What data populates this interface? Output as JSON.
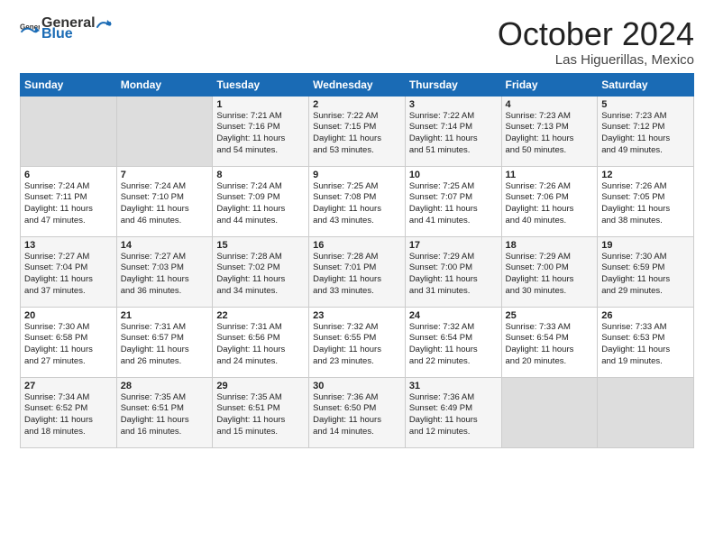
{
  "header": {
    "logo_general": "General",
    "logo_blue": "Blue",
    "month": "October 2024",
    "location": "Las Higuerillas, Mexico"
  },
  "days_of_week": [
    "Sunday",
    "Monday",
    "Tuesday",
    "Wednesday",
    "Thursday",
    "Friday",
    "Saturday"
  ],
  "weeks": [
    [
      {
        "day": "",
        "empty": true
      },
      {
        "day": "",
        "empty": true
      },
      {
        "day": "1",
        "lines": [
          "Sunrise: 7:21 AM",
          "Sunset: 7:16 PM",
          "Daylight: 11 hours",
          "and 54 minutes."
        ]
      },
      {
        "day": "2",
        "lines": [
          "Sunrise: 7:22 AM",
          "Sunset: 7:15 PM",
          "Daylight: 11 hours",
          "and 53 minutes."
        ]
      },
      {
        "day": "3",
        "lines": [
          "Sunrise: 7:22 AM",
          "Sunset: 7:14 PM",
          "Daylight: 11 hours",
          "and 51 minutes."
        ]
      },
      {
        "day": "4",
        "lines": [
          "Sunrise: 7:23 AM",
          "Sunset: 7:13 PM",
          "Daylight: 11 hours",
          "and 50 minutes."
        ]
      },
      {
        "day": "5",
        "lines": [
          "Sunrise: 7:23 AM",
          "Sunset: 7:12 PM",
          "Daylight: 11 hours",
          "and 49 minutes."
        ]
      }
    ],
    [
      {
        "day": "6",
        "lines": [
          "Sunrise: 7:24 AM",
          "Sunset: 7:11 PM",
          "Daylight: 11 hours",
          "and 47 minutes."
        ]
      },
      {
        "day": "7",
        "lines": [
          "Sunrise: 7:24 AM",
          "Sunset: 7:10 PM",
          "Daylight: 11 hours",
          "and 46 minutes."
        ]
      },
      {
        "day": "8",
        "lines": [
          "Sunrise: 7:24 AM",
          "Sunset: 7:09 PM",
          "Daylight: 11 hours",
          "and 44 minutes."
        ]
      },
      {
        "day": "9",
        "lines": [
          "Sunrise: 7:25 AM",
          "Sunset: 7:08 PM",
          "Daylight: 11 hours",
          "and 43 minutes."
        ]
      },
      {
        "day": "10",
        "lines": [
          "Sunrise: 7:25 AM",
          "Sunset: 7:07 PM",
          "Daylight: 11 hours",
          "and 41 minutes."
        ]
      },
      {
        "day": "11",
        "lines": [
          "Sunrise: 7:26 AM",
          "Sunset: 7:06 PM",
          "Daylight: 11 hours",
          "and 40 minutes."
        ]
      },
      {
        "day": "12",
        "lines": [
          "Sunrise: 7:26 AM",
          "Sunset: 7:05 PM",
          "Daylight: 11 hours",
          "and 38 minutes."
        ]
      }
    ],
    [
      {
        "day": "13",
        "lines": [
          "Sunrise: 7:27 AM",
          "Sunset: 7:04 PM",
          "Daylight: 11 hours",
          "and 37 minutes."
        ]
      },
      {
        "day": "14",
        "lines": [
          "Sunrise: 7:27 AM",
          "Sunset: 7:03 PM",
          "Daylight: 11 hours",
          "and 36 minutes."
        ]
      },
      {
        "day": "15",
        "lines": [
          "Sunrise: 7:28 AM",
          "Sunset: 7:02 PM",
          "Daylight: 11 hours",
          "and 34 minutes."
        ]
      },
      {
        "day": "16",
        "lines": [
          "Sunrise: 7:28 AM",
          "Sunset: 7:01 PM",
          "Daylight: 11 hours",
          "and 33 minutes."
        ]
      },
      {
        "day": "17",
        "lines": [
          "Sunrise: 7:29 AM",
          "Sunset: 7:00 PM",
          "Daylight: 11 hours",
          "and 31 minutes."
        ]
      },
      {
        "day": "18",
        "lines": [
          "Sunrise: 7:29 AM",
          "Sunset: 7:00 PM",
          "Daylight: 11 hours",
          "and 30 minutes."
        ]
      },
      {
        "day": "19",
        "lines": [
          "Sunrise: 7:30 AM",
          "Sunset: 6:59 PM",
          "Daylight: 11 hours",
          "and 29 minutes."
        ]
      }
    ],
    [
      {
        "day": "20",
        "lines": [
          "Sunrise: 7:30 AM",
          "Sunset: 6:58 PM",
          "Daylight: 11 hours",
          "and 27 minutes."
        ]
      },
      {
        "day": "21",
        "lines": [
          "Sunrise: 7:31 AM",
          "Sunset: 6:57 PM",
          "Daylight: 11 hours",
          "and 26 minutes."
        ]
      },
      {
        "day": "22",
        "lines": [
          "Sunrise: 7:31 AM",
          "Sunset: 6:56 PM",
          "Daylight: 11 hours",
          "and 24 minutes."
        ]
      },
      {
        "day": "23",
        "lines": [
          "Sunrise: 7:32 AM",
          "Sunset: 6:55 PM",
          "Daylight: 11 hours",
          "and 23 minutes."
        ]
      },
      {
        "day": "24",
        "lines": [
          "Sunrise: 7:32 AM",
          "Sunset: 6:54 PM",
          "Daylight: 11 hours",
          "and 22 minutes."
        ]
      },
      {
        "day": "25",
        "lines": [
          "Sunrise: 7:33 AM",
          "Sunset: 6:54 PM",
          "Daylight: 11 hours",
          "and 20 minutes."
        ]
      },
      {
        "day": "26",
        "lines": [
          "Sunrise: 7:33 AM",
          "Sunset: 6:53 PM",
          "Daylight: 11 hours",
          "and 19 minutes."
        ]
      }
    ],
    [
      {
        "day": "27",
        "lines": [
          "Sunrise: 7:34 AM",
          "Sunset: 6:52 PM",
          "Daylight: 11 hours",
          "and 18 minutes."
        ]
      },
      {
        "day": "28",
        "lines": [
          "Sunrise: 7:35 AM",
          "Sunset: 6:51 PM",
          "Daylight: 11 hours",
          "and 16 minutes."
        ]
      },
      {
        "day": "29",
        "lines": [
          "Sunrise: 7:35 AM",
          "Sunset: 6:51 PM",
          "Daylight: 11 hours",
          "and 15 minutes."
        ]
      },
      {
        "day": "30",
        "lines": [
          "Sunrise: 7:36 AM",
          "Sunset: 6:50 PM",
          "Daylight: 11 hours",
          "and 14 minutes."
        ]
      },
      {
        "day": "31",
        "lines": [
          "Sunrise: 7:36 AM",
          "Sunset: 6:49 PM",
          "Daylight: 11 hours",
          "and 12 minutes."
        ]
      },
      {
        "day": "",
        "empty": true
      },
      {
        "day": "",
        "empty": true
      }
    ]
  ]
}
